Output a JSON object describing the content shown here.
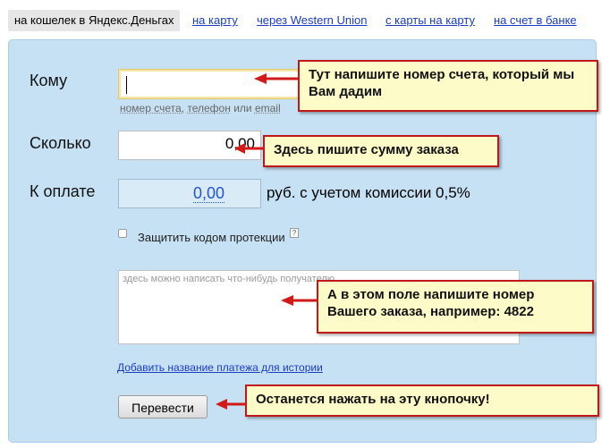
{
  "tabs": [
    {
      "label": "на кошелек в Яндекс.Деньгах",
      "active": true
    },
    {
      "label": "на карту"
    },
    {
      "label": "через Western Union"
    },
    {
      "label": "с карты на карту"
    },
    {
      "label": "на счет в банке"
    }
  ],
  "form": {
    "recipient_label": "Кому",
    "recipient_hint_1": "номер счета,",
    "recipient_hint_2": "телефон",
    "recipient_hint_3": "или",
    "recipient_hint_4": "email",
    "amount_label": "Сколько",
    "amount_value": "0,00",
    "pay_label": "К оплате",
    "pay_value": "0,00",
    "pay_suffix": "руб. с учетом комиссии 0,5%",
    "protect_label": "Защитить кодом протекции",
    "help_glyph": "?",
    "comment_placeholder": "здесь можно написать что-нибудь получателю",
    "add_title_link": "Добавить название платежа для истории",
    "submit_label": "Перевести"
  },
  "callouts": {
    "account": "Тут напишите номер счета, который мы Вам дадим",
    "amount": "Здесь пишите сумму заказа",
    "order": "А в этом поле напишите номер Вашего заказа, например: 4822",
    "button": "Останется нажать на эту кнопочку!"
  },
  "colors": {
    "panel_bg": "#c7e1f4",
    "link": "#1a3dc1",
    "callout_bg": "#fdfbc8",
    "callout_border": "#c0181a",
    "arrow": "#d21a1a"
  }
}
